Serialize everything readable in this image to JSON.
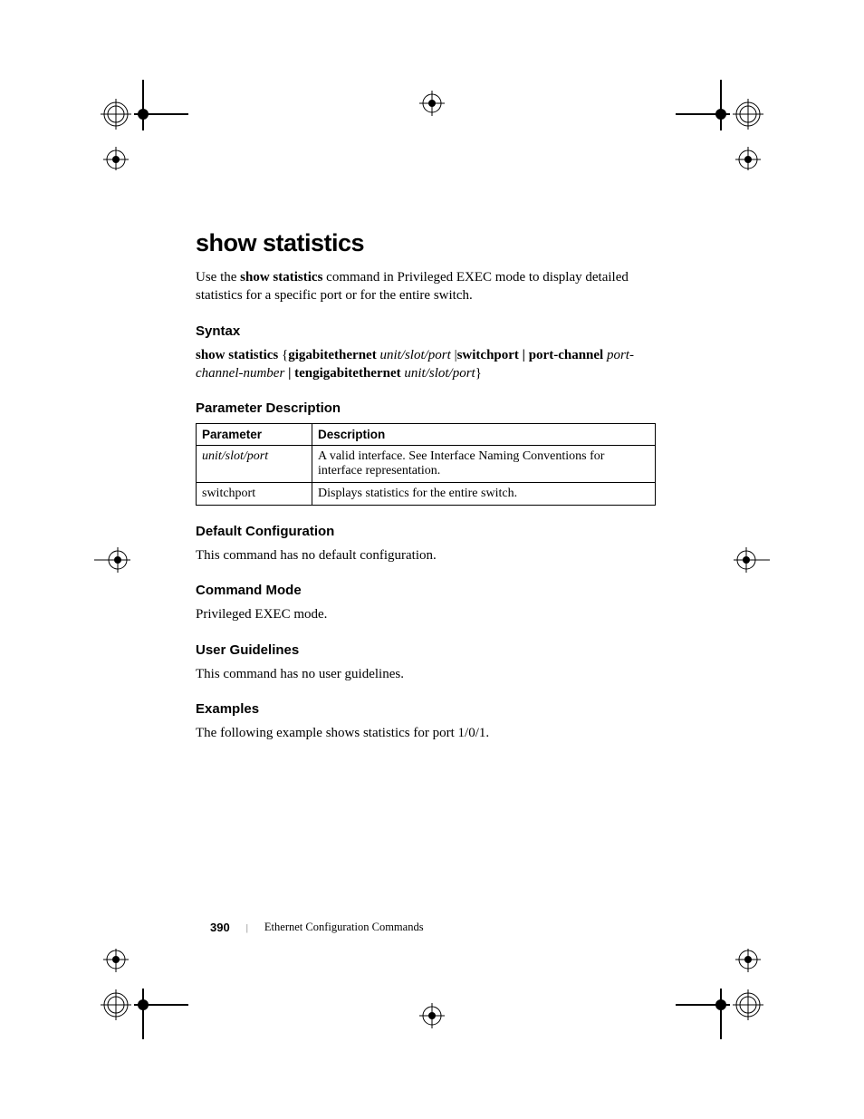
{
  "title": "show statistics",
  "intro_pre": "Use the ",
  "intro_cmd": "show statistics",
  "intro_post": " command in Privileged EXEC mode to display detailed statistics for a specific port or for the entire switch.",
  "syntax": {
    "heading": "Syntax",
    "cmd1": "show statistics",
    "brace_open": " {",
    "kw1": "gigabitethernet",
    "arg1": " unit/slot/port ",
    "pipe1": "|",
    "kw2": "switchport",
    "pipe2": " | ",
    "kw3": "port-channel",
    "arg2": "port-channel-number",
    "pipe3": " | ",
    "kw4": "tengigabitethernet",
    "arg3": " unit/slot/port",
    "brace_close": "}"
  },
  "param_desc": {
    "heading": "Parameter Description",
    "th1": "Parameter",
    "th2": "Description",
    "rows": [
      {
        "p": "unit/slot/port",
        "d": "A valid interface. See Interface Naming Conventions for interface representation."
      },
      {
        "p": "switchport",
        "d": "Displays statistics for the entire switch."
      }
    ]
  },
  "default_config": {
    "heading": "Default Configuration",
    "body": "This command has no default configuration."
  },
  "command_mode": {
    "heading": "Command Mode",
    "body": "Privileged EXEC mode."
  },
  "user_guidelines": {
    "heading": "User Guidelines",
    "body": "This command has no user guidelines."
  },
  "examples": {
    "heading": "Examples",
    "body": "The following example shows statistics for port 1/0/1."
  },
  "footer": {
    "page": "390",
    "title": "Ethernet Configuration Commands"
  }
}
